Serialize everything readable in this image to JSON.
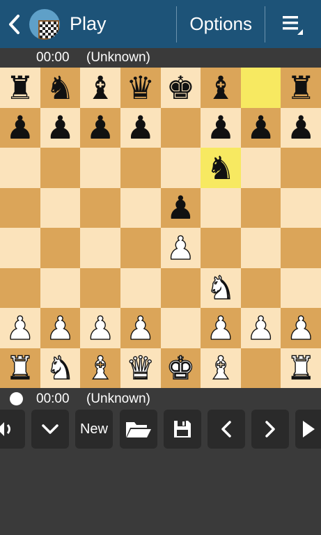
{
  "header": {
    "title": "Play",
    "options_label": "Options",
    "back_icon": "chevron-left-icon",
    "menu_icon": "menu-icon",
    "bg_color": "#1d5378"
  },
  "opponent": {
    "clock": "00:00",
    "name": "(Unknown)"
  },
  "player": {
    "clock": "00:00",
    "name": "(Unknown)"
  },
  "board": {
    "light_color": "#fbe3bb",
    "dark_color": "#dba559",
    "highlight_color": "#f7e961",
    "rows": [
      [
        "r",
        "n",
        "b",
        "q",
        "k",
        "b",
        "",
        "r"
      ],
      [
        "p",
        "p",
        "p",
        "p",
        "",
        "p",
        "p",
        "p"
      ],
      [
        "",
        "",
        "",
        "",
        "",
        "n",
        "",
        ""
      ],
      [
        "",
        "",
        "",
        "",
        "p",
        "",
        "",
        ""
      ],
      [
        "",
        "",
        "",
        "",
        "P",
        "",
        "",
        ""
      ],
      [
        "",
        "",
        "",
        "",
        "",
        "N",
        "",
        ""
      ],
      [
        "P",
        "P",
        "P",
        "P",
        "",
        "P",
        "P",
        "P"
      ],
      [
        "R",
        "N",
        "B",
        "Q",
        "K",
        "B",
        "",
        "R"
      ]
    ],
    "highlights": [
      [
        0,
        6
      ],
      [
        2,
        5
      ]
    ]
  },
  "toolbar": {
    "new_label": "New",
    "icons": [
      "sound-icon",
      "chevron-down-icon",
      "folder-open-icon",
      "save-icon",
      "chevron-left-icon",
      "chevron-right-icon",
      "play-icon"
    ]
  }
}
